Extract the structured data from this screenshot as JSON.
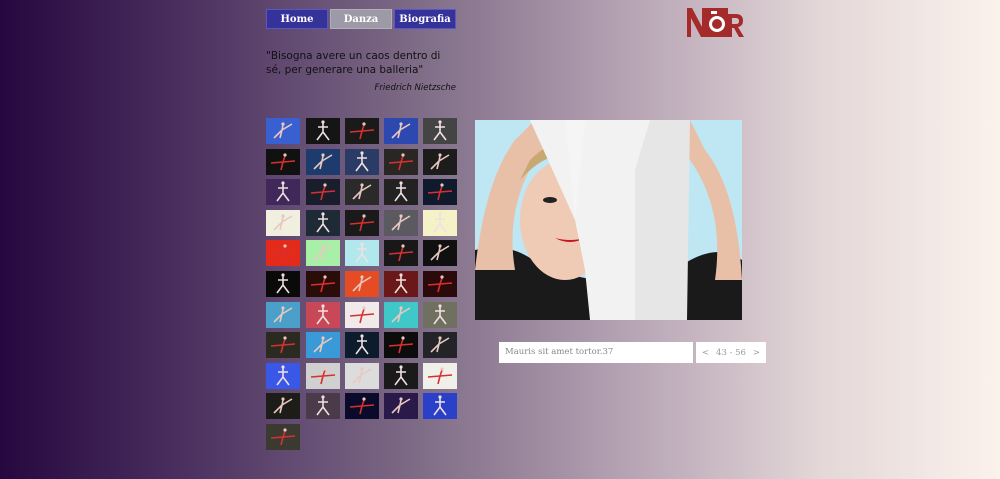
{
  "nav": {
    "items": [
      {
        "label": "Home",
        "active": false
      },
      {
        "label": "Danza",
        "active": true
      },
      {
        "label": "Biografia",
        "active": false
      }
    ]
  },
  "logo": {
    "text": "NOR",
    "color": "#a52a2a",
    "icon": "camera-logo-icon"
  },
  "quote": {
    "text": "\"Bisogna avere un caos dentro di sé, per generare una balleria\"",
    "author": "Friedrich Nietzsche"
  },
  "gallery": {
    "thumbnail_count": 51,
    "thumbnails": [
      "#3a5fd0",
      "#151515",
      "#1a1a1a",
      "#2d49b0",
      "#444444",
      "#111111",
      "#1d3c6d",
      "#2a3c66",
      "#2a2624",
      "#1c1c1c",
      "#40285a",
      "#1a1e2c",
      "#2a2a2a",
      "#222222",
      "#0f1a2c",
      "#f0efe0",
      "#1e2a35",
      "#1a1a1a",
      "#5a5a60",
      "#f5f2c8",
      "#e42a1a",
      "#a8f0a8",
      "#b0e8ee",
      "#181818",
      "#101010",
      "#0a0a0a",
      "#2a0c08",
      "#e64c24",
      "#6a1818",
      "#2a0a0a",
      "#4aa0c8",
      "#c84858",
      "#f0eaea",
      "#40c8c8",
      "#707060",
      "#2a2a20",
      "#3a9ad8",
      "#0c1c2c",
      "#0c0c0c",
      "#222428",
      "#3a58e8",
      "#d0d0d0",
      "#dcdcdc",
      "#1a1a1a",
      "#f0f0ea",
      "#1c1c18",
      "#4a3a4a",
      "#0a0a2a",
      "#2a1a4a",
      "#2a40c8",
      "#3a3a30",
      "#b0d0f0",
      "#1a1010",
      "#141014",
      "#d0e0e8",
      "#5c6aa8"
    ]
  },
  "viewer": {
    "caption_placeholder": "Mauris sit amet tortor.37",
    "pager": {
      "prev": "<",
      "range": "43 - 56",
      "next": ">"
    }
  }
}
